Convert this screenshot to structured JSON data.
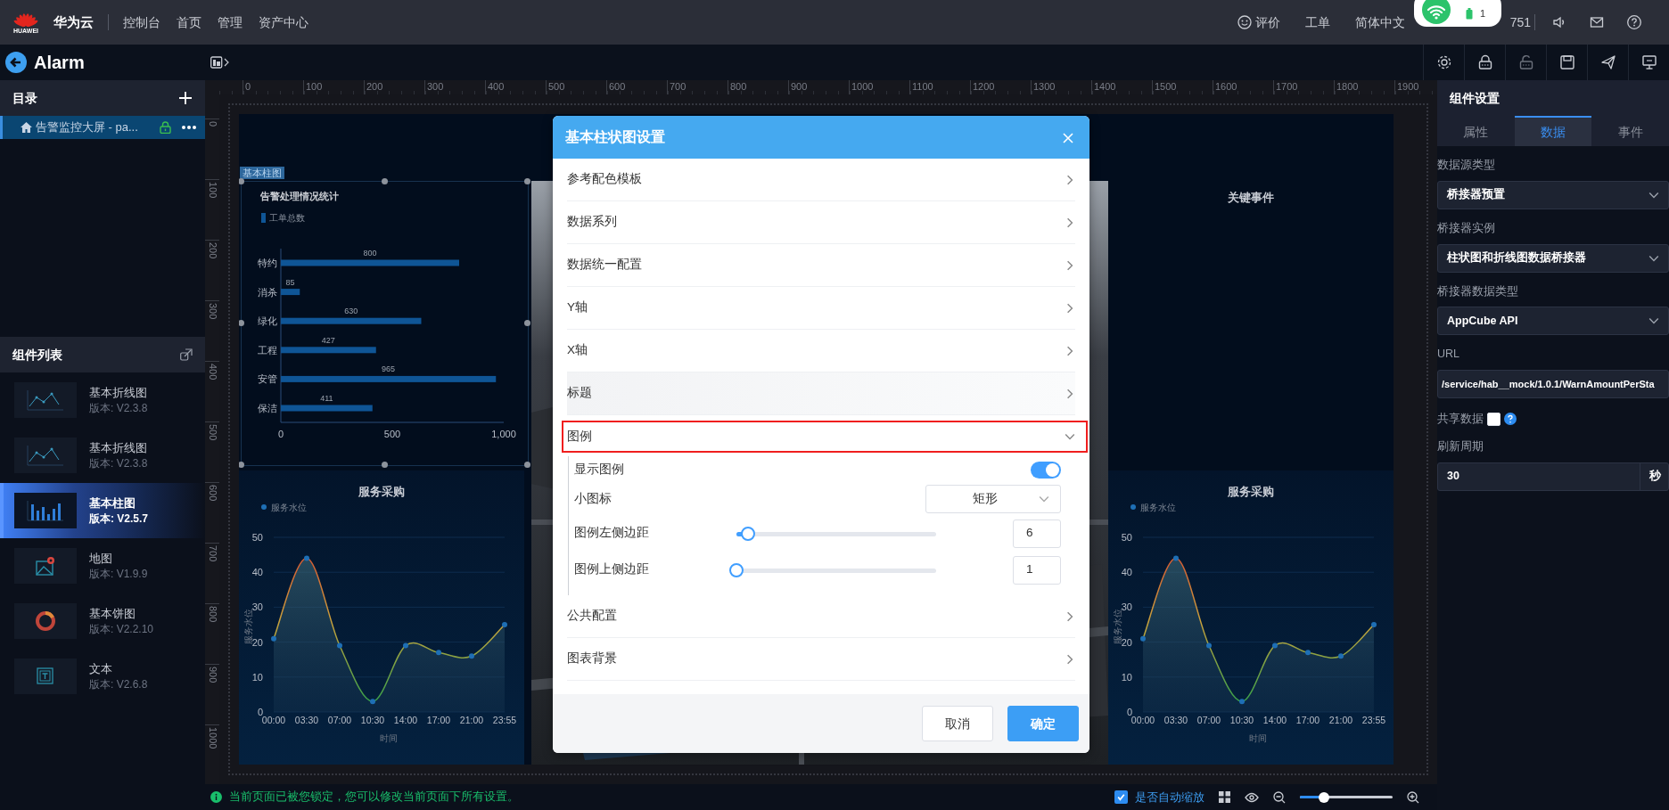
{
  "top_bar": {
    "logo_text": "HUAWEI",
    "brand": "华为云",
    "nav": [
      "控制台",
      "首页",
      "管理",
      "资产中心"
    ],
    "right_links": [
      {
        "label": "评价",
        "kind": "feedback"
      },
      {
        "label": "工单",
        "kind": "plain"
      },
      {
        "label": "简体中文",
        "kind": "plain"
      },
      {
        "label": "751",
        "kind": "account"
      }
    ]
  },
  "status_popup": {
    "battery": "1"
  },
  "editor_bar": {
    "title": "Alarm"
  },
  "directory": {
    "title": "目录",
    "items": [
      {
        "label": "告警监控大屏 - pa...",
        "selected": true,
        "locked": true
      }
    ]
  },
  "components": {
    "title": "组件列表",
    "items": [
      {
        "name": "基本折线图",
        "version": "版本: V2.3.8",
        "kind": "line",
        "selected": false
      },
      {
        "name": "基本折线图",
        "version": "版本: V2.3.8",
        "kind": "line",
        "selected": false
      },
      {
        "name": "基本柱图",
        "version": "版本: V2.5.7",
        "kind": "bar",
        "selected": true
      },
      {
        "name": "地图",
        "version": "版本: V1.9.9",
        "kind": "map",
        "selected": false
      },
      {
        "name": "基本饼图",
        "version": "版本: V2.2.10",
        "kind": "pie",
        "selected": false
      },
      {
        "name": "文本",
        "version": "版本: V2.6.8",
        "kind": "text",
        "selected": false
      }
    ]
  },
  "ruler": {
    "x_labels": [
      "0",
      "100",
      "200",
      "300",
      "400",
      "500",
      "600",
      "700",
      "800",
      "900",
      "1000",
      "1100",
      "1200",
      "1300",
      "1400",
      "1500",
      "1600",
      "1700",
      "1800",
      "1900"
    ],
    "y_labels": [
      "0",
      "100",
      "200",
      "300",
      "400",
      "500",
      "600",
      "700",
      "800",
      "900",
      "1000"
    ]
  },
  "canvas": {
    "bar_widget": {
      "tag": "基本柱图",
      "chart_data": {
        "type": "bar",
        "orientation": "horizontal",
        "title": "告警处理情况统计",
        "categories": [
          "特约",
          "消杀",
          "绿化",
          "工程",
          "安管",
          "保洁"
        ],
        "series": [
          {
            "name": "工单总数",
            "color": "#0f5596",
            "values": [
              800,
              85,
              630,
              427,
              965,
              411
            ]
          }
        ],
        "xlim": [
          0,
          1000
        ],
        "xticks": [
          0,
          500,
          {
            "value": 1000,
            "label": "1,000"
          }
        ],
        "data_labels": true
      }
    },
    "right_title": "关键事件",
    "line_widgets": [
      {
        "chart_data": {
          "type": "area",
          "title": "服务采购",
          "xlabel": "时间",
          "ylabel": "服务水位",
          "categories": [
            "00:00",
            "03:30",
            "07:00",
            "10:30",
            "14:00",
            "17:00",
            "21:00",
            "23:55"
          ],
          "series": [
            {
              "name": "服务水位",
              "color": "#1e6fb5",
              "values": [
                21,
                44,
                19,
                3,
                19,
                17,
                16,
                25
              ]
            }
          ],
          "ylim": [
            0,
            50
          ],
          "yticks": [
            0,
            10,
            20,
            30,
            40,
            50
          ],
          "grid": true
        }
      },
      {
        "chart_data": {
          "type": "area",
          "title": "服务采购",
          "xlabel": "时间",
          "ylabel": "服务水位",
          "categories": [
            "00:00",
            "03:30",
            "07:00",
            "10:30",
            "14:00",
            "17:00",
            "21:00",
            "23:55"
          ],
          "series": [
            {
              "name": "服务水位",
              "color": "#1e6fb5",
              "values": [
                21,
                44,
                19,
                3,
                19,
                17,
                16,
                25
              ]
            }
          ],
          "ylim": [
            0,
            50
          ],
          "yticks": [
            0,
            10,
            20,
            30,
            40,
            50
          ],
          "grid": true
        }
      }
    ]
  },
  "dialog": {
    "title": "基本柱状图设置",
    "sections": [
      {
        "label": "参考配色模板",
        "expanded": false,
        "hovered": false,
        "highlighted": false
      },
      {
        "label": "数据系列",
        "expanded": false,
        "hovered": false,
        "highlighted": false
      },
      {
        "label": "数据统一配置",
        "expanded": false,
        "hovered": false,
        "highlighted": false
      },
      {
        "label": "Y轴",
        "expanded": false,
        "hovered": false,
        "highlighted": false
      },
      {
        "label": "X轴",
        "expanded": false,
        "hovered": false,
        "highlighted": false
      },
      {
        "label": "标题",
        "expanded": false,
        "hovered": true,
        "highlighted": false
      },
      {
        "label": "图例",
        "expanded": true,
        "hovered": false,
        "highlighted": true,
        "fields": [
          {
            "kind": "toggle",
            "label": "显示图例",
            "on": true
          },
          {
            "kind": "select",
            "label": "小图标",
            "value": "矩形"
          },
          {
            "kind": "slider",
            "label": "图例左侧边距",
            "level": 0.06,
            "value": "6"
          },
          {
            "kind": "slider",
            "label": "图例上侧边距",
            "level": 0.0,
            "value": "1"
          }
        ]
      },
      {
        "label": "公共配置",
        "expanded": false,
        "hovered": false,
        "highlighted": false
      },
      {
        "label": "图表背景",
        "expanded": false,
        "hovered": false,
        "highlighted": false
      }
    ],
    "buttons": [
      {
        "label": "取消",
        "kind": "secondary"
      },
      {
        "label": "确定",
        "kind": "primary"
      }
    ]
  },
  "settings_panel": {
    "title": "组件设置",
    "tabs": [
      {
        "label": "属性",
        "selected": false
      },
      {
        "label": "数据",
        "selected": true
      },
      {
        "label": "事件",
        "selected": false
      }
    ],
    "fields": [
      {
        "kind": "select",
        "label": "数据源类型",
        "value": "桥接器预置"
      },
      {
        "kind": "select",
        "label": "桥接器实例",
        "value": "柱状图和折线图数据桥接器"
      },
      {
        "kind": "select",
        "label": "桥接器数据类型",
        "value": "AppCube API"
      },
      {
        "kind": "input",
        "label": "URL",
        "value": "/service/hab__mock/1.0.1/WarnAmountPerSta"
      },
      {
        "kind": "checkbox",
        "label": "共享数据",
        "checked": false
      },
      {
        "kind": "number",
        "label": "刷新周期",
        "value": "30",
        "unit": "秒"
      }
    ]
  },
  "status_bar": {
    "message": "当前页面已被您锁定，您可以修改当前页面下所有设置。",
    "auto_zoom": {
      "label": "是否自动缩放",
      "checked": true
    },
    "zoom": {
      "level": 0.26
    }
  }
}
